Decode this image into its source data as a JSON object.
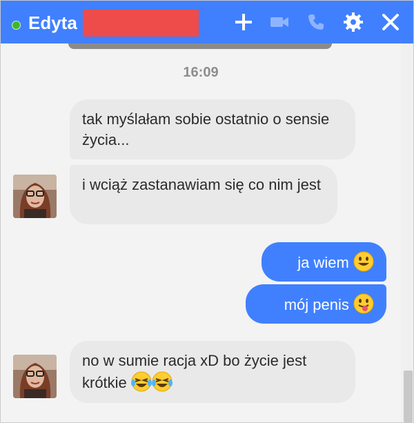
{
  "header": {
    "contact_name": "Edyta",
    "status": "online",
    "icons": [
      "plus-icon",
      "video-icon",
      "phone-icon",
      "gear-icon",
      "close-icon"
    ]
  },
  "timestamp": "16:09",
  "messages": [
    {
      "from": "contact",
      "text": "tak myślałam sobie ostatnio o sensie życia..."
    },
    {
      "from": "contact",
      "text": "i wciąż zastanawiam się co nim jest"
    },
    {
      "from": "me",
      "text": "ja wiem",
      "emoji": "smiley-emoji"
    },
    {
      "from": "me",
      "text": "mój penis",
      "emoji": "tongue-emoji"
    },
    {
      "from": "contact",
      "text": "no w sumie racja xD bo życie jest krótkie",
      "emoji": "laughing-tears-emoji x2"
    }
  ],
  "colors": {
    "header": "#4080ff",
    "outgoing_bubble": "#4080ff",
    "incoming_bubble": "#e9e9ea",
    "redaction": "#ee4b4b",
    "online": "#42b72a"
  }
}
